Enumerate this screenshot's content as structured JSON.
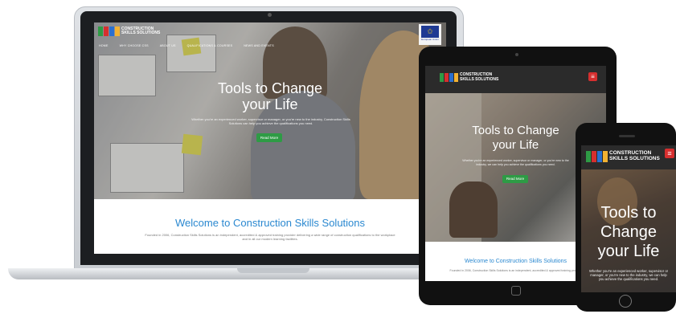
{
  "brand": {
    "name_line1": "CONSTRUCTION",
    "name_line2": "SKILLS SOLUTIONS",
    "logo_colors": [
      "#2e9b45",
      "#d62f2f",
      "#2a6fd0",
      "#f2b233"
    ]
  },
  "laptop": {
    "nav": [
      "HOME",
      "WHY CHOOSE CSS",
      "ABOUT US",
      "QUALIFICATIONS & COURSES",
      "NEWS AND EVENTS"
    ],
    "eu_label": "European Union",
    "hero_title_line1": "Tools to Change",
    "hero_title_line2": "your Life",
    "hero_subtitle": "Whether you're an experienced worker, supervisor or manager, or you're new to the industry, Construction Skills Solutions can help you achieve the qualifications you need.",
    "cta_label": "Read More",
    "welcome_title": "Welcome to Construction Skills Solutions",
    "welcome_text": "Founded in 2006, Construction Skills Solutions is an independent, accredited & approved training provider delivering a wide range of construction qualifications to the workplace and in all our modern learning facilities."
  },
  "tablet": {
    "menu_icon": "≡",
    "hero_title_line1": "Tools to Change",
    "hero_title_line2": "your Life",
    "hero_subtitle": "Whether you're an experienced worker, supervisor or manager, or you're new to the industry, we can help you achieve the qualifications you need.",
    "cta_label": "Read More",
    "welcome_title": "Welcome to Construction Skills Solutions",
    "welcome_text": "Founded in 2006, Construction Skills Solutions is an independent, accredited & approved training provider"
  },
  "phone": {
    "menu_icon": "≡",
    "hero_title_line1": "Tools to",
    "hero_title_line2": "Change",
    "hero_title_line3": "your Life",
    "hero_subtitle": "Whether you're an experienced worker, supervisor or manager, or you're new to the industry, we can help you achieve the qualifications you need."
  },
  "colors": {
    "accent_blue": "#2a88d0",
    "cta_green": "#2e9b45",
    "menu_red": "#d62f2f"
  }
}
